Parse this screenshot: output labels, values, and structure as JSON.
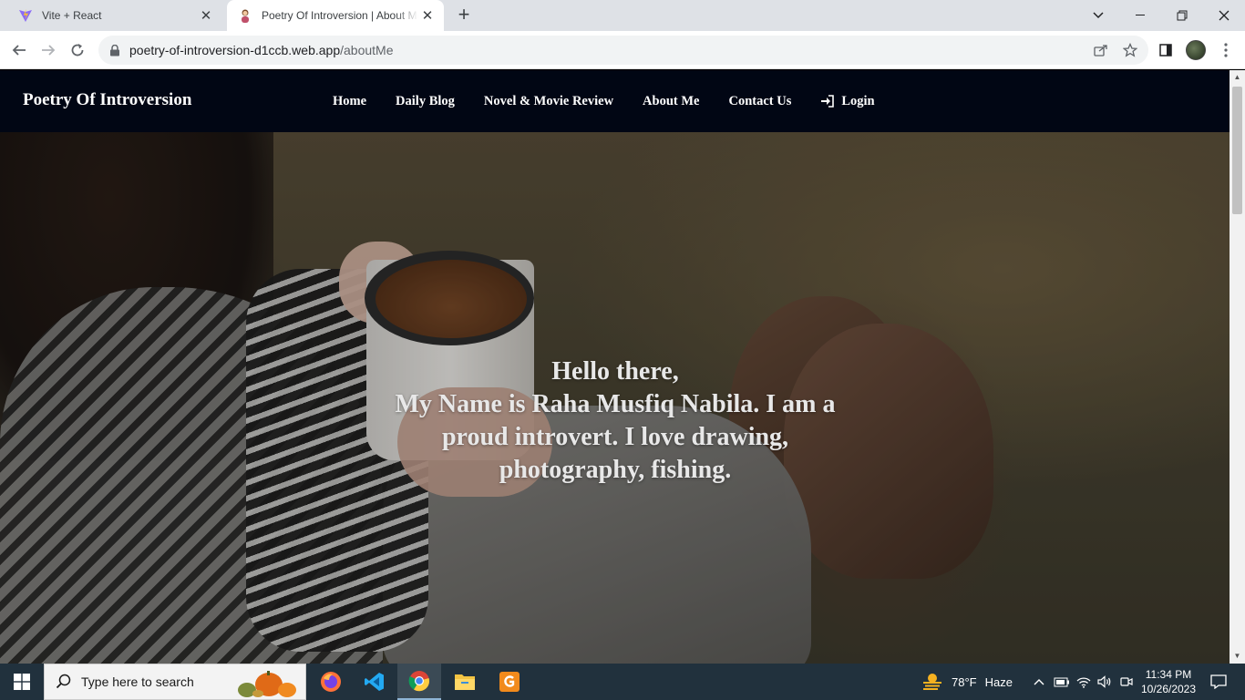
{
  "browser": {
    "tabs": [
      {
        "title": "Vite + React",
        "favicon": "vite-icon"
      },
      {
        "title": "Poetry Of Introversion | About Me",
        "favicon": "person-icon"
      }
    ],
    "url_host": "poetry-of-introversion-d1ccb.web.app",
    "url_path": "/aboutMe"
  },
  "site": {
    "brand": "Poetry Of Introversion",
    "nav": [
      "Home",
      "Daily Blog",
      "Novel & Movie Review",
      "About Me",
      "Contact Us"
    ],
    "login_label": "Login"
  },
  "hero": {
    "greeting": "Hello there,",
    "intro": "My Name is Raha Musfiq Nabila. I am a proud introvert. I love drawing, photography, fishing."
  },
  "taskbar": {
    "search_placeholder": "Type here to search",
    "weather_temp": "78°F",
    "weather_desc": "Haze",
    "time": "11:34 PM",
    "date": "10/26/2023"
  },
  "colors": {
    "site_nav_bg": "#010614",
    "taskbar_bg": "#21313d",
    "tabstrip_bg": "#dee1e6"
  }
}
